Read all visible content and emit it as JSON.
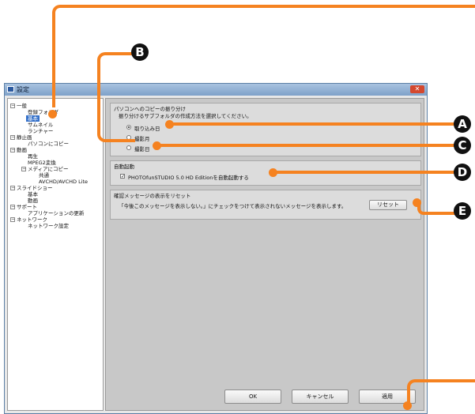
{
  "window": {
    "title": "設定",
    "close_glyph": "✕"
  },
  "tree": [
    {
      "label": "一般",
      "expander": "−"
    },
    {
      "label": "登録フォルダ"
    },
    {
      "label": "基本",
      "selected": true
    },
    {
      "label": "サムネイル"
    },
    {
      "label": "ランチャー"
    },
    {
      "label": "静止画",
      "expander": "−"
    },
    {
      "label": "パソコンにコピー"
    },
    {
      "label": "動画",
      "expander": "−"
    },
    {
      "label": "再生"
    },
    {
      "label": "MPEG2変換"
    },
    {
      "label": "メディアにコピー",
      "expander": "−"
    },
    {
      "label": "共通"
    },
    {
      "label": "AVCHD/AVCHD Lite"
    },
    {
      "label": "スライドショー",
      "expander": "−"
    },
    {
      "label": "基本"
    },
    {
      "label": "動画"
    },
    {
      "label": "サポート",
      "expander": "−"
    },
    {
      "label": "アプリケーションの更新"
    },
    {
      "label": "ネットワーク",
      "expander": "−"
    },
    {
      "label": "ネットワーク設定"
    }
  ],
  "copy_group": {
    "title": "パソコンへのコピーの振り分け",
    "description": "振り分けるサブフォルダの作成方法を選択してください。",
    "options": [
      {
        "label": "取り込み日",
        "checked": true
      },
      {
        "label": "撮影月",
        "checked": false
      },
      {
        "label": "撮影日",
        "checked": false
      }
    ]
  },
  "autostart_group": {
    "title": "自動起動",
    "checkbox_label": "PHOTOfunSTUDIO 5.0 HD Editionを自動起動する",
    "checked": true,
    "check_glyph": "✓"
  },
  "reset_group": {
    "title": "確認メッセージの表示をリセット",
    "description": "「今後このメッセージを表示しない。」にチェックをつけて表示されないメッセージを表示します。",
    "reset_label": "リセット"
  },
  "footer": {
    "ok_label": "OK",
    "cancel_label": "キャンセル",
    "apply_label": "適用"
  },
  "callouts": {
    "A": "A",
    "B": "B",
    "C": "C",
    "D": "D",
    "E": "E"
  },
  "colors": {
    "callout_line": "#f58220",
    "callout_badge": "#111111",
    "selection": "#3470c8"
  }
}
